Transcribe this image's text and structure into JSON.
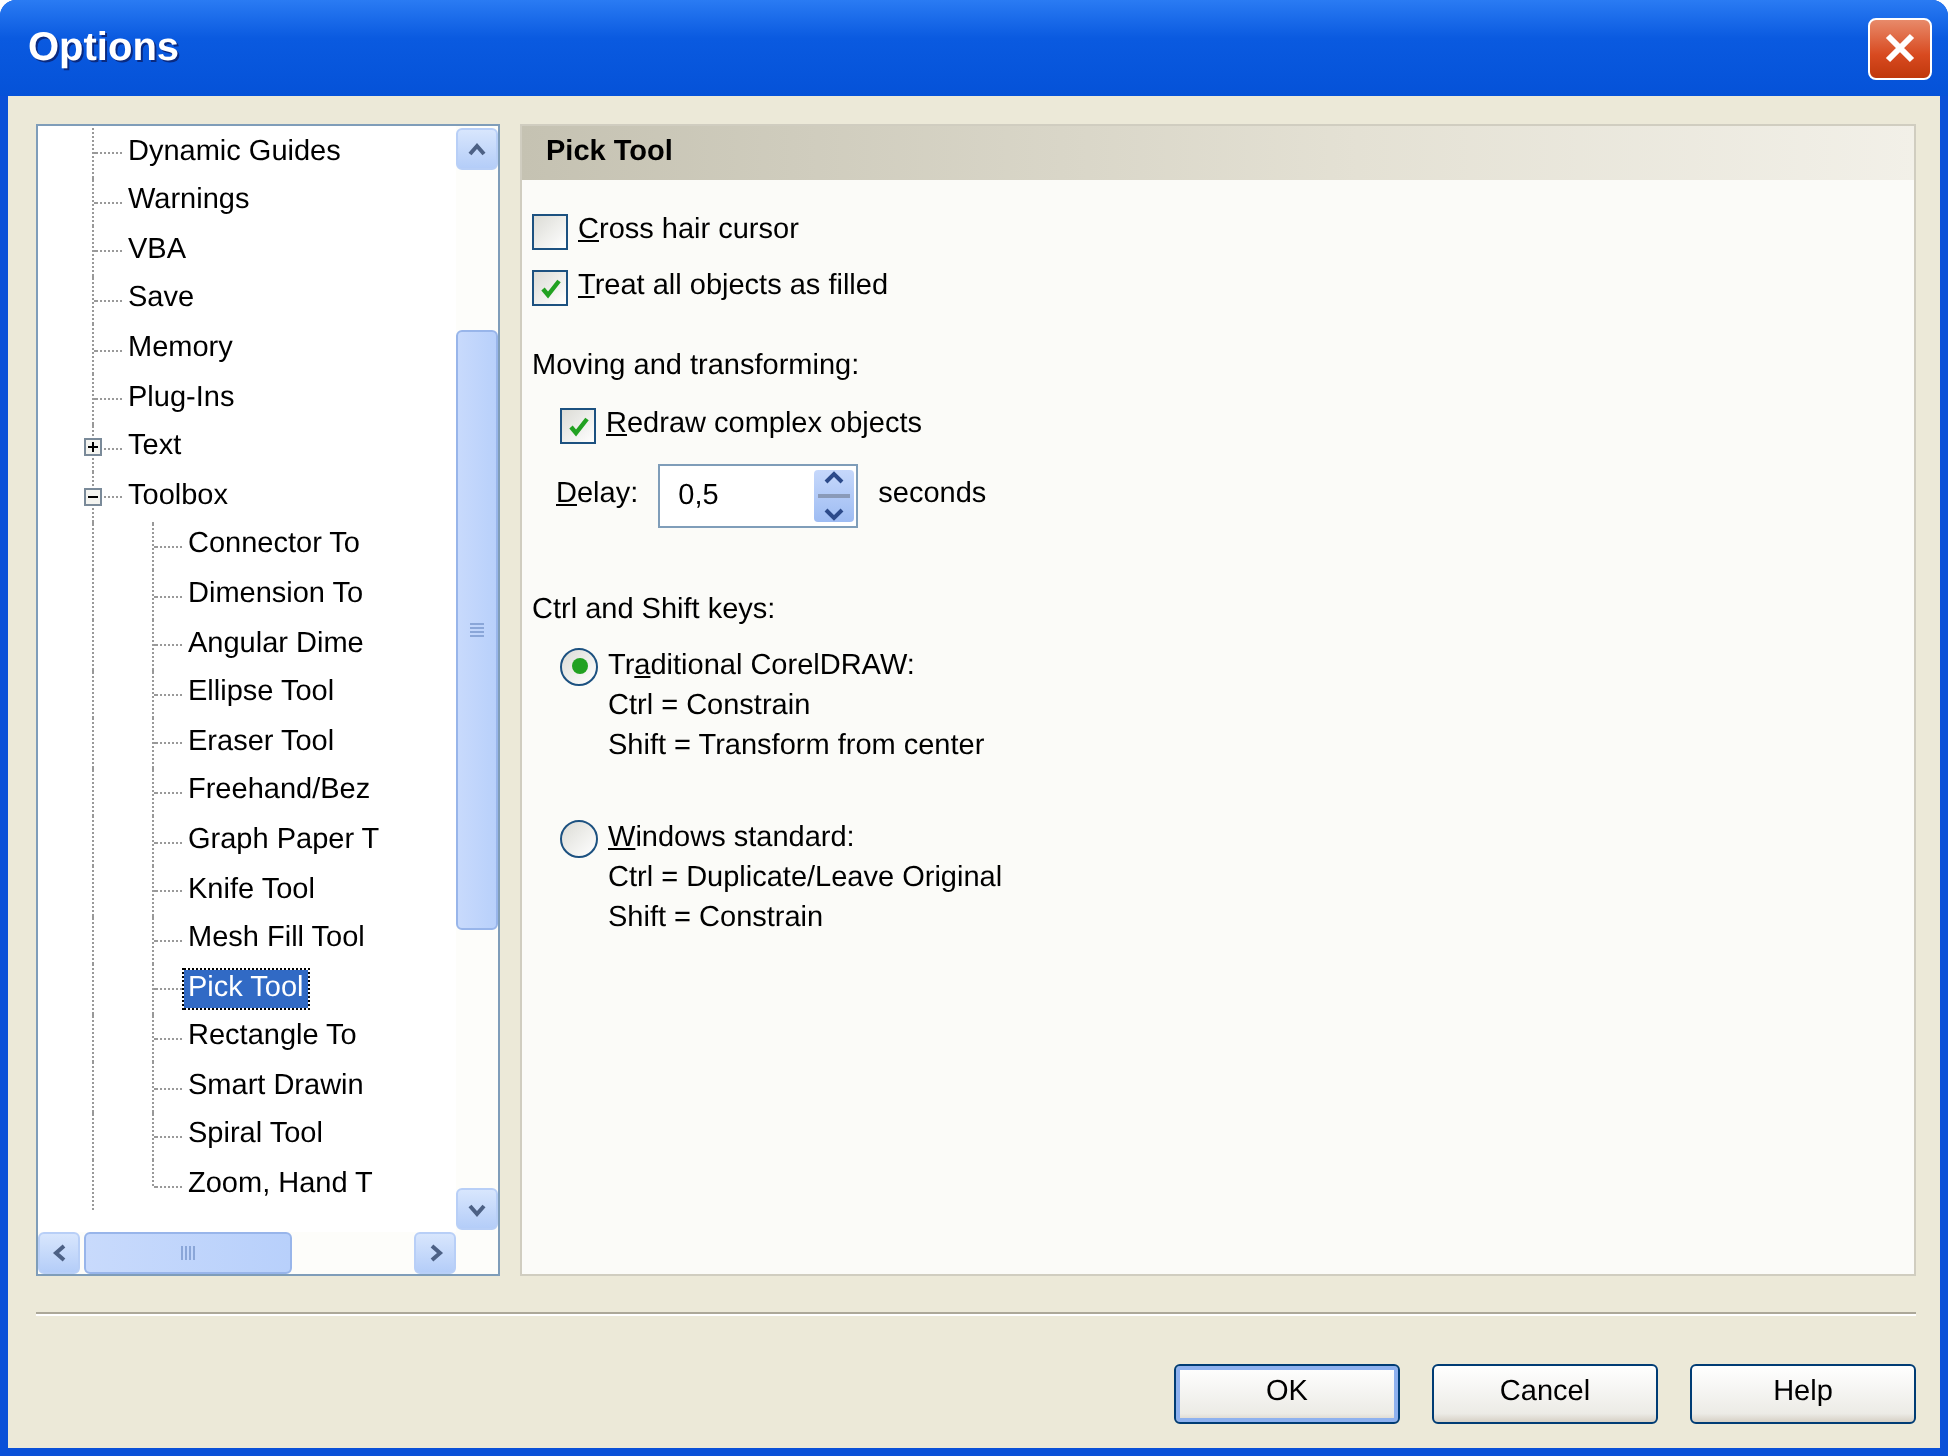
{
  "window": {
    "title": "Options"
  },
  "tree": {
    "items": [
      {
        "label": "Dynamic Guides",
        "selected": false
      },
      {
        "label": "Warnings",
        "selected": false
      },
      {
        "label": "VBA",
        "selected": false
      },
      {
        "label": "Save",
        "selected": false
      },
      {
        "label": "Memory",
        "selected": false
      },
      {
        "label": "Plug-Ins",
        "selected": false
      },
      {
        "label": "Text",
        "expanded": false,
        "selected": false
      },
      {
        "label": "Toolbox",
        "expanded": true,
        "selected": false,
        "children": [
          {
            "label": "Connector To",
            "selected": false
          },
          {
            "label": "Dimension To",
            "selected": false
          },
          {
            "label": "Angular Dime",
            "selected": false
          },
          {
            "label": "Ellipse Tool",
            "selected": false
          },
          {
            "label": "Eraser Tool",
            "selected": false
          },
          {
            "label": "Freehand/Bez",
            "selected": false
          },
          {
            "label": "Graph Paper T",
            "selected": false
          },
          {
            "label": "Knife Tool",
            "selected": false
          },
          {
            "label": "Mesh Fill Tool",
            "selected": false
          },
          {
            "label": "Pick Tool",
            "selected": true
          },
          {
            "label": "Rectangle To",
            "selected": false
          },
          {
            "label": "Smart Drawin",
            "selected": false
          },
          {
            "label": "Spiral Tool",
            "selected": false
          },
          {
            "label": "Zoom, Hand T",
            "selected": false
          }
        ]
      }
    ]
  },
  "panel": {
    "title": "Pick Tool",
    "options": [
      {
        "access_key": "C",
        "after": "ross hair cursor",
        "checked": false
      },
      {
        "access_key": "T",
        "after": "reat all objects as filled",
        "checked": true
      }
    ],
    "moving": {
      "heading": "Moving and transforming:",
      "redraw": {
        "access_key": "R",
        "after": "edraw complex objects",
        "checked": true
      },
      "delay": {
        "access_key": "D",
        "after": "elay:",
        "value": "0,5",
        "unit": "seconds"
      }
    },
    "keys": {
      "heading": "Ctrl and Shift keys:",
      "choices": [
        {
          "before": "Tr",
          "access_key": "a",
          "after": "ditional CorelDRAW:",
          "lines": [
            "Ctrl = Constrain",
            "Shift = Transform from center"
          ],
          "selected": true
        },
        {
          "access_key": "W",
          "after": "indows standard:",
          "lines": [
            "Ctrl = Duplicate/Leave Original",
            "Shift = Constrain"
          ],
          "selected": false
        }
      ]
    }
  },
  "buttons": [
    {
      "label": "OK",
      "default": true
    },
    {
      "label": "Cancel",
      "default": false
    },
    {
      "label": "Help",
      "default": false
    }
  ]
}
